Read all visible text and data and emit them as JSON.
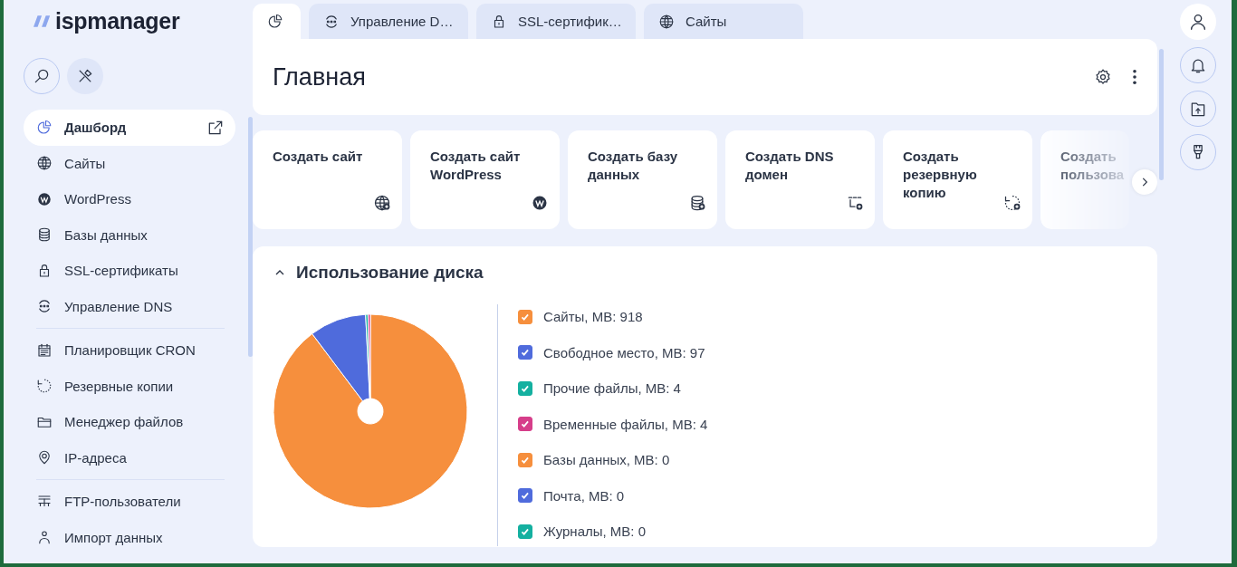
{
  "logo": {
    "text": "ispmanager"
  },
  "sidebar": {
    "groups": [
      {
        "items": [
          {
            "label": "Дашборд",
            "selected": true
          },
          {
            "label": "Сайты",
            "selected": false
          },
          {
            "label": "WordPress",
            "selected": false
          },
          {
            "label": "Базы данных",
            "selected": false
          },
          {
            "label": "SSL-сертификаты",
            "selected": false
          },
          {
            "label": "Управление DNS",
            "selected": false
          }
        ]
      },
      {
        "items": [
          {
            "label": "Планировщик CRON",
            "selected": false
          },
          {
            "label": "Резервные копии",
            "selected": false
          },
          {
            "label": "Менеджер файлов",
            "selected": false
          },
          {
            "label": "IP-адреса",
            "selected": false
          }
        ]
      },
      {
        "items": [
          {
            "label": "FTP-пользователи",
            "selected": false
          },
          {
            "label": "Импорт данных",
            "selected": false
          }
        ]
      }
    ]
  },
  "tabs": [
    {
      "selected": true
    },
    {
      "label": "Управление D…",
      "selected": false
    },
    {
      "label": "SSL-сертифик…",
      "selected": false
    },
    {
      "label": "Сайты",
      "selected": false
    }
  ],
  "page": {
    "title": "Главная"
  },
  "actions": [
    {
      "label": "Создать сайт"
    },
    {
      "label": "Создать сайт WordPress"
    },
    {
      "label": "Создать базу данных"
    },
    {
      "label": "Создать DNS домен"
    },
    {
      "label": "Создать резервную копию"
    },
    {
      "label": "Создать пользова"
    }
  ],
  "disk_usage": {
    "title": "Использование диска",
    "expanded": true,
    "legend": [
      {
        "color": "#f68f3d",
        "checked": true
      },
      {
        "color": "#4f6bdc",
        "checked": true
      },
      {
        "color": "#14b0a0",
        "checked": true
      },
      {
        "color": "#d63e8a",
        "checked": true
      },
      {
        "color": "#f68f3d",
        "checked": true
      },
      {
        "color": "#4f6bdc",
        "checked": true
      },
      {
        "color": "#14b0a0",
        "checked": true
      }
    ],
    "chart_data": {
      "type": "donut",
      "categories": [
        "Сайты, MB: 918",
        "Свободное место, MB: 97",
        "Прочие файлы, MB: 4",
        "Временные файлы, MB: 4",
        "Базы данных, MB: 0",
        "Почта, MB: 0",
        "Журналы, MB: 0"
      ],
      "values": [
        918,
        97,
        4,
        4,
        0,
        0,
        0
      ]
    }
  }
}
